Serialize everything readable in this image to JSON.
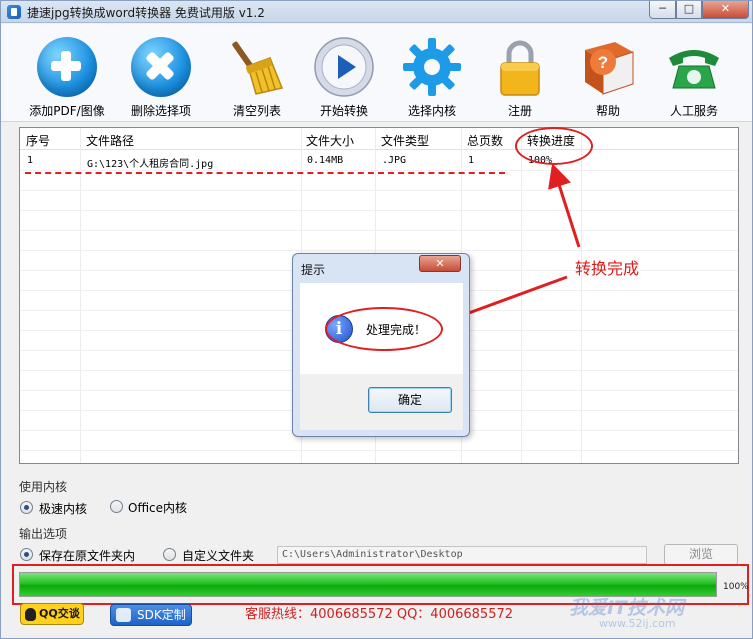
{
  "window": {
    "title": "捷速jpg转换成word转换器 免费试用版 v1.2",
    "controls": {
      "minimize": "─",
      "maximize": "□",
      "close": "✕"
    }
  },
  "toolbar": {
    "items": [
      {
        "label": "添加PDF/图像",
        "icon": "add-plus-icon"
      },
      {
        "label": "删除选择项",
        "icon": "delete-x-icon"
      },
      {
        "label": "清空列表",
        "icon": "broom-icon"
      },
      {
        "label": "开始转换",
        "icon": "play-icon"
      },
      {
        "label": "选择内核",
        "icon": "gear-icon"
      },
      {
        "label": "注册",
        "icon": "lock-icon"
      },
      {
        "label": "帮助",
        "icon": "help-book-icon"
      },
      {
        "label": "人工服务",
        "icon": "telephone-icon"
      }
    ]
  },
  "file_table": {
    "columns": [
      "序号",
      "文件路径",
      "文件大小",
      "文件类型",
      "总页数",
      "转换进度"
    ],
    "rows": [
      {
        "index": "1",
        "path": "G:\\123\\个人租房合同.jpg",
        "size": "0.14MB",
        "type": ".JPG",
        "pages": "1",
        "progress": "100%"
      }
    ]
  },
  "annotation": {
    "label": "转换完成",
    "color": "#e02020"
  },
  "dialog": {
    "title": "提示",
    "close_label": "✕",
    "icon": "info-icon",
    "icon_glyph": "i",
    "message": "处理完成！",
    "ok_label": "确定"
  },
  "kernel": {
    "section_label": "使用内核",
    "options": [
      {
        "label": "极速内核",
        "selected": true
      },
      {
        "label": "Office内核",
        "selected": false
      }
    ]
  },
  "output": {
    "section_label": "输出选项",
    "options": [
      {
        "label": "保存在原文件夹内",
        "selected": true
      },
      {
        "label": "自定义文件夹",
        "selected": false
      }
    ],
    "path_value": "C:\\Users\\Administrator\\Desktop",
    "browse_label": "浏览"
  },
  "progress": {
    "value": 1.0,
    "label": "100%"
  },
  "footer": {
    "qq_label": "QQ交谈",
    "sdk_label": "SDK定制",
    "hotline": "客服热线：4006685572 QQ：4006685572"
  },
  "watermark": {
    "text": "我爱IT技术网",
    "sub": "www.52ij.com"
  }
}
